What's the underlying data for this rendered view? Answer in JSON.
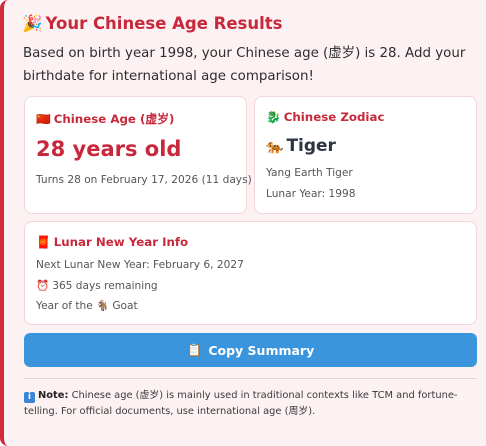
{
  "header": {
    "icon": "party-popper-icon",
    "title": "Your Chinese Age Results",
    "intro": "Based on birth year 1998, your Chinese age (虚岁) is 28. Add your birthdate for international age comparison!"
  },
  "age_card": {
    "icon": "china-flag-icon",
    "heading": "Chinese Age (虚岁)",
    "value": "28 years old",
    "turns": "Turns 28 on February 17, 2026 (11 days)"
  },
  "zodiac_card": {
    "icon": "dragon-icon",
    "heading": "Chinese Zodiac",
    "animal_icon": "tiger-icon",
    "animal": "Tiger",
    "element": "Yang Earth Tiger",
    "lunar_year": "Lunar Year: 1998"
  },
  "lny_card": {
    "icon": "red-envelope-icon",
    "heading": "Lunar New Year Info",
    "next": "Next Lunar New Year: February 6, 2027",
    "remaining_icon": "alarm-clock-icon",
    "remaining": "365 days remaining",
    "year_prefix": "Year of the",
    "year_icon": "goat-icon",
    "year_animal": "Goat"
  },
  "actions": {
    "copy_icon": "clipboard-icon",
    "copy_label": "Copy Summary"
  },
  "note": {
    "icon": "info-icon",
    "label": "Note:",
    "text": "Chinese age (虚岁) is mainly used in traditional contexts like TCM and fortune-telling. For official documents, use international age (周岁)."
  },
  "colors": {
    "accent": "#c8283b",
    "button": "#3a95dc",
    "panel_bg": "#fdf2f3"
  }
}
